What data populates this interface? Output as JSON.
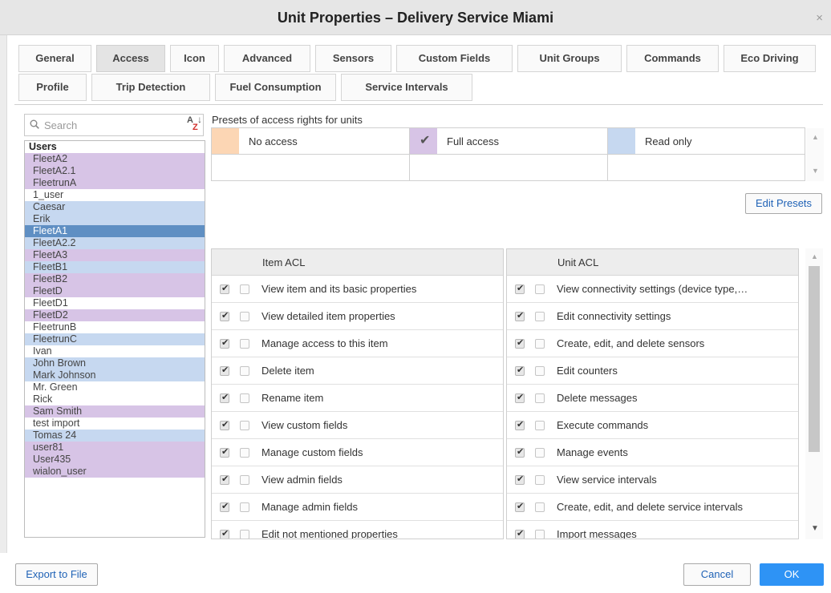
{
  "window": {
    "title": "Unit Properties – Delivery Service Miami",
    "close_glyph": "×"
  },
  "tabs_row1": [
    "General",
    "Access",
    "Icon",
    "Advanced",
    "Sensors",
    "Custom Fields",
    "Unit Groups",
    "Commands",
    "Eco Driving"
  ],
  "tabs_row2": [
    "Profile",
    "Trip Detection",
    "Fuel Consumption",
    "Service Intervals"
  ],
  "active_tab": "Access",
  "search": {
    "placeholder": "Search"
  },
  "users": {
    "header": "Users",
    "items": [
      {
        "name": "FleetA2",
        "access": "full"
      },
      {
        "name": "FleetA2.1",
        "access": "full"
      },
      {
        "name": "FleetrunA",
        "access": "full"
      },
      {
        "name": "1_user",
        "access": "none"
      },
      {
        "name": "Caesar",
        "access": "read"
      },
      {
        "name": "Erik",
        "access": "read"
      },
      {
        "name": "FleetA1",
        "access": "selected"
      },
      {
        "name": "FleetA2.2",
        "access": "read"
      },
      {
        "name": "FleetA3",
        "access": "full"
      },
      {
        "name": "FleetB1",
        "access": "read"
      },
      {
        "name": "FleetB2",
        "access": "full"
      },
      {
        "name": "FleetD",
        "access": "full"
      },
      {
        "name": "FleetD1",
        "access": "none"
      },
      {
        "name": "FleetD2",
        "access": "full"
      },
      {
        "name": "FleetrunB",
        "access": "none"
      },
      {
        "name": "FleetrunC",
        "access": "read"
      },
      {
        "name": "Ivan",
        "access": "none"
      },
      {
        "name": "John Brown",
        "access": "read"
      },
      {
        "name": "Mark Johnson",
        "access": "read"
      },
      {
        "name": "Mr. Green",
        "access": "none"
      },
      {
        "name": "Rick",
        "access": "none"
      },
      {
        "name": "Sam Smith",
        "access": "full"
      },
      {
        "name": "test import",
        "access": "none"
      },
      {
        "name": "Tomas 24",
        "access": "read"
      },
      {
        "name": "user81",
        "access": "full"
      },
      {
        "name": "User435",
        "access": "full"
      },
      {
        "name": "wialon_user",
        "access": "full"
      }
    ]
  },
  "presets": {
    "label": "Presets of access rights for units",
    "items": [
      {
        "label": "No access",
        "color": "#fcd6b4",
        "checked": false
      },
      {
        "label": "Full access",
        "color": "#d7c4e6",
        "checked": true
      },
      {
        "label": "Read only",
        "color": "#c6d8f0",
        "checked": false
      }
    ],
    "edit_button": "Edit Presets"
  },
  "item_acl": {
    "header": "Item ACL",
    "rows": [
      "View item and its basic properties",
      "View detailed item properties",
      "Manage access to this item",
      "Delete item",
      "Rename item",
      "View custom fields",
      "Manage custom fields",
      "View admin fields",
      "Manage admin fields",
      "Edit not mentioned properties"
    ]
  },
  "unit_acl": {
    "header": "Unit ACL",
    "rows": [
      "View connectivity settings (device type,…",
      "Edit connectivity settings",
      "Create, edit, and delete sensors",
      "Edit counters",
      "Delete messages",
      "Execute commands",
      "Manage events",
      "View service intervals",
      "Create, edit, and delete service intervals",
      "Import messages"
    ]
  },
  "footer": {
    "export_label": "Export to File",
    "cancel_label": "Cancel",
    "ok_label": "OK"
  },
  "colors": {
    "full": "#d7c4e6",
    "read": "#c6d8f0",
    "none_preset": "#fcd6b4",
    "selected": "#5f8fc3",
    "primary": "#2e93f5",
    "link": "#1f62b6"
  }
}
